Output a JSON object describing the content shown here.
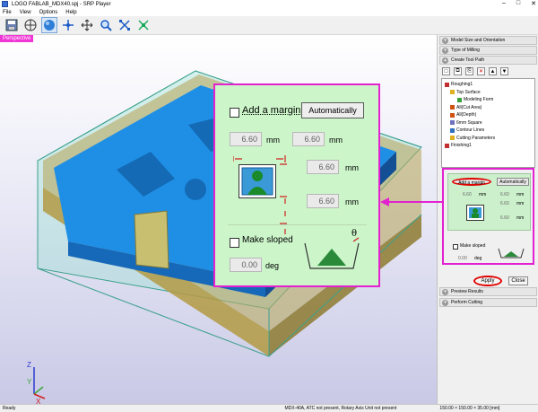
{
  "window": {
    "title": "LOGO FABLAB_MDX40.spj - SRP Player",
    "controls": [
      "–",
      "□",
      "✕"
    ]
  },
  "menu": [
    "File",
    "View",
    "Options",
    "Help"
  ],
  "toolbar": {
    "icons": [
      "save-icon",
      "grid-icon",
      "sphere-view-icon",
      "rotate-icon",
      "pan-icon",
      "zoom-icon",
      "fit-icon",
      "zoom-window-icon"
    ]
  },
  "viewport": {
    "label": "Perspective",
    "axes": {
      "z": "Z",
      "y": "Y",
      "x": "X"
    }
  },
  "panel": {
    "sections_top": [
      "Model Size and Orientation",
      "Type of Milling",
      "Create Tool Path"
    ],
    "tree": [
      "Roughing1",
      "Top Surface",
      "Modeling Form",
      "All(Cut Area)",
      "All(Depth)",
      "6mm Square",
      "Contour Lines",
      "Cutting Parameters",
      "Finishing1"
    ],
    "sections_bottom": [
      "Preview Results",
      "Perform Cutting"
    ],
    "apply_label": "Apply",
    "close_label": "Close"
  },
  "mini_dialog": {
    "add_margin_label": "Add a margin",
    "auto_label": "Automatically",
    "values": [
      "6.60",
      "6.60",
      "6.60",
      "6.60"
    ],
    "unit": "mm",
    "make_sloped_label": "Make sloped",
    "angle": "0.00",
    "angle_unit": "deg"
  },
  "popup": {
    "add_margin_label": "Add a margin",
    "auto_label": "Automatically",
    "margin_x": "6.60",
    "margin_y": "6.60",
    "margin_side": "6.60",
    "margin_bottom": "6.60",
    "unit": "mm",
    "make_sloped_label": "Make sloped",
    "angle": "0.00",
    "angle_unit": "deg",
    "theta": "θ"
  },
  "status": {
    "left": "Ready",
    "middle": "MDX-40A, ATC not present, Rotary Axis Unit not present",
    "right": "150.00 × 150.00 × 35.00 [mm]"
  },
  "colors": {
    "accent": "#e321d1",
    "panel_green": "#ccf5c9",
    "highlight": "#e00000"
  }
}
